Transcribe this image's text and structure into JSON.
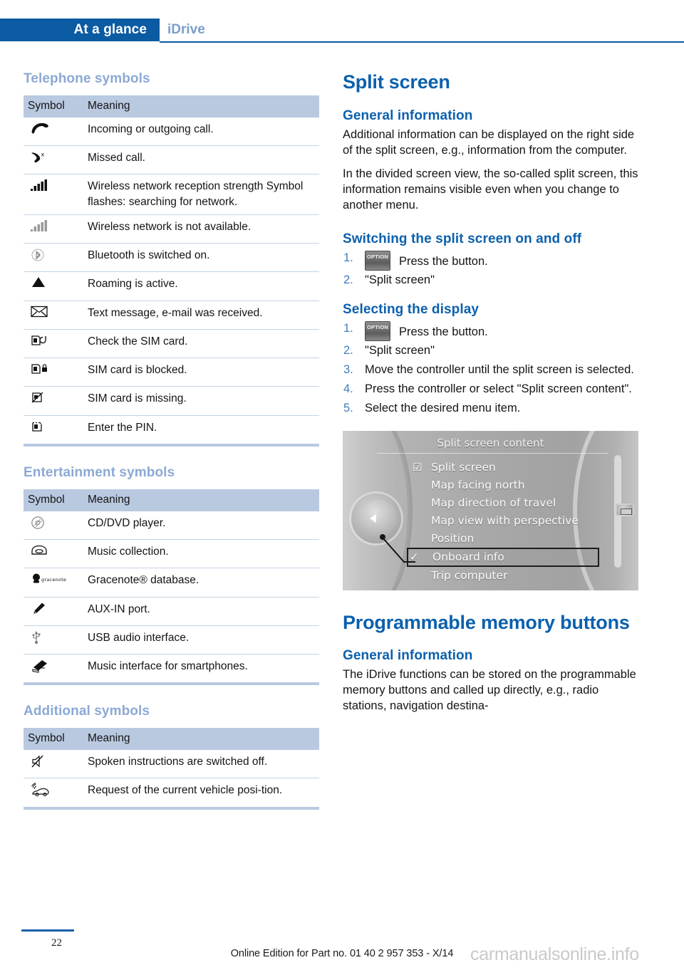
{
  "header": {
    "active_tab": "At a glance",
    "inactive_tab": "iDrive"
  },
  "left_column": {
    "telephone": {
      "heading": "Telephone symbols",
      "columns": [
        "Symbol",
        "Meaning"
      ],
      "rows": [
        {
          "icon": "phone-handset-icon",
          "meaning": "Incoming or outgoing call."
        },
        {
          "icon": "missed-call-icon",
          "meaning": "Missed call."
        },
        {
          "icon": "signal-bars-full-icon",
          "meaning": "Wireless network reception strength Symbol flashes: searching for network."
        },
        {
          "icon": "signal-bars-gray-icon",
          "meaning": "Wireless network is not available."
        },
        {
          "icon": "bluetooth-icon",
          "meaning": "Bluetooth is switched on."
        },
        {
          "icon": "roaming-triangle-icon",
          "meaning": "Roaming is active."
        },
        {
          "icon": "envelope-icon",
          "meaning": "Text message, e-mail was received."
        },
        {
          "icon": "sim-check-icon",
          "meaning": "Check the SIM card."
        },
        {
          "icon": "sim-locked-icon",
          "meaning": "SIM card is blocked."
        },
        {
          "icon": "sim-missing-icon",
          "meaning": "SIM card is missing."
        },
        {
          "icon": "sim-pin-icon",
          "meaning": "Enter the PIN."
        }
      ]
    },
    "entertainment": {
      "heading": "Entertainment symbols",
      "columns": [
        "Symbol",
        "Meaning"
      ],
      "rows": [
        {
          "icon": "cd-dvd-icon",
          "meaning": "CD/DVD player."
        },
        {
          "icon": "music-collection-icon",
          "meaning": "Music collection."
        },
        {
          "icon": "gracenote-icon",
          "meaning": "Gracenote® database."
        },
        {
          "icon": "aux-in-icon",
          "meaning": "AUX-IN port."
        },
        {
          "icon": "usb-icon",
          "meaning": "USB audio interface."
        },
        {
          "icon": "smartphone-interface-icon",
          "meaning": "Music interface for smartphones."
        }
      ]
    },
    "additional": {
      "heading": "Additional symbols",
      "columns": [
        "Symbol",
        "Meaning"
      ],
      "rows": [
        {
          "icon": "speaker-muted-icon",
          "meaning": "Spoken instructions are switched off."
        },
        {
          "icon": "vehicle-position-icon",
          "meaning": "Request of the current vehicle posi-tion."
        }
      ]
    }
  },
  "right_column": {
    "split_screen": {
      "title": "Split screen",
      "general_heading": "General information",
      "paragraphs": [
        "Additional information can be displayed on the right side of the split screen, e.g., information from the computer.",
        "In the divided screen view, the so-called split screen, this information remains visible even when you change to another menu."
      ],
      "switching_heading": "Switching the split screen on and off",
      "switching_steps": [
        {
          "num": "1.",
          "button": "OPTION",
          "text": "Press the button."
        },
        {
          "num": "2.",
          "button": "",
          "text": "\"Split screen\""
        }
      ],
      "selecting_heading": "Selecting the display",
      "selecting_steps": [
        {
          "num": "1.",
          "button": "OPTION",
          "text": "Press the button."
        },
        {
          "num": "2.",
          "button": "",
          "text": "\"Split screen\""
        },
        {
          "num": "3.",
          "button": "",
          "text": "Move the controller until the split screen is selected."
        },
        {
          "num": "4.",
          "button": "",
          "text": "Press the controller or select \"Split screen content\"."
        },
        {
          "num": "5.",
          "button": "",
          "text": "Select the desired menu item."
        }
      ]
    },
    "idrive_figure": {
      "title": "Split screen content",
      "menu_items": [
        {
          "mark": "checkbox",
          "label": "Split screen",
          "highlighted": false
        },
        {
          "mark": "",
          "label": "Map facing north",
          "highlighted": false
        },
        {
          "mark": "",
          "label": "Map direction of travel",
          "highlighted": false
        },
        {
          "mark": "",
          "label": "Map view with perspective",
          "highlighted": false
        },
        {
          "mark": "",
          "label": "Position",
          "highlighted": false
        },
        {
          "mark": "check",
          "label": "Onboard info",
          "highlighted": true
        },
        {
          "mark": "",
          "label": "Trip computer",
          "highlighted": false
        }
      ]
    },
    "memory_buttons": {
      "title": "Programmable memory buttons",
      "general_heading": "General information",
      "paragraph": "The iDrive functions can be stored on the programmable memory buttons and called up directly, e.g., radio stations, navigation destina-"
    }
  },
  "footer": {
    "page_number": "22",
    "edition": "Online Edition for Part no. 01 40 2 957 353 - X/14",
    "watermark": "carmanualsonline.info"
  },
  "colors": {
    "tab_blue": "#0b5ba3",
    "heading_blue": "#0b60ad",
    "muted_blue": "#8ca9d4",
    "table_header_blue": "#b9c9e0",
    "step_number_blue": "#3f7cc0"
  }
}
